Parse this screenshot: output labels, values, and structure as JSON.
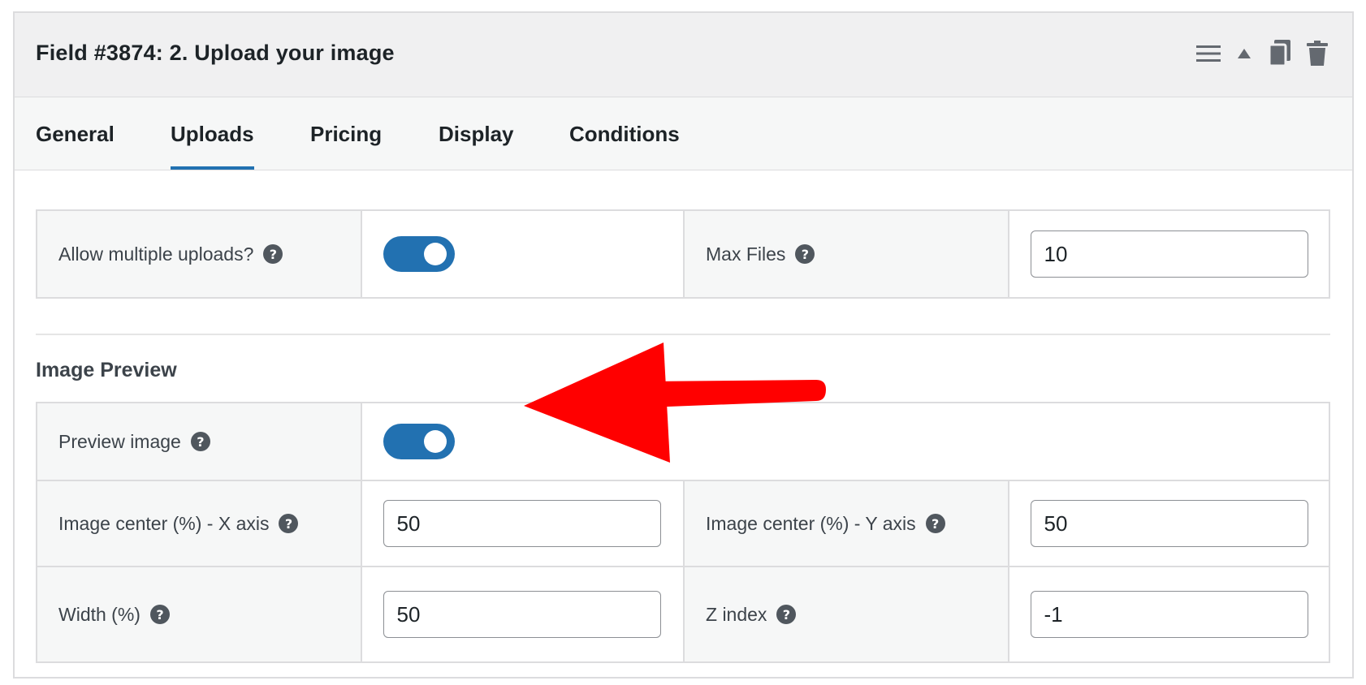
{
  "panel": {
    "title": "Field #3874: 2. Upload your image",
    "actions": [
      "menu-icon",
      "collapse-up-icon",
      "duplicate-icon",
      "trash-icon"
    ]
  },
  "tabs": [
    {
      "label": "General",
      "active": false
    },
    {
      "label": "Uploads",
      "active": true
    },
    {
      "label": "Pricing",
      "active": false
    },
    {
      "label": "Display",
      "active": false
    },
    {
      "label": "Conditions",
      "active": false
    }
  ],
  "uploads": {
    "allow_multiple": {
      "label": "Allow multiple uploads?",
      "enabled": true
    },
    "max_files": {
      "label": "Max Files",
      "value": "10"
    }
  },
  "image_preview": {
    "heading": "Image Preview",
    "preview_image": {
      "label": "Preview image",
      "enabled": true
    },
    "center_x": {
      "label": "Image center (%) - X axis",
      "value": "50"
    },
    "center_y": {
      "label": "Image center (%) - Y axis",
      "value": "50"
    },
    "width": {
      "label": "Width (%)",
      "value": "50"
    },
    "z_index": {
      "label": "Z index",
      "value": "-1"
    }
  },
  "help_glyph": "?",
  "colors": {
    "accent": "#2271b1",
    "header_bg": "#f0f0f1",
    "arrow": "#ff0000"
  }
}
